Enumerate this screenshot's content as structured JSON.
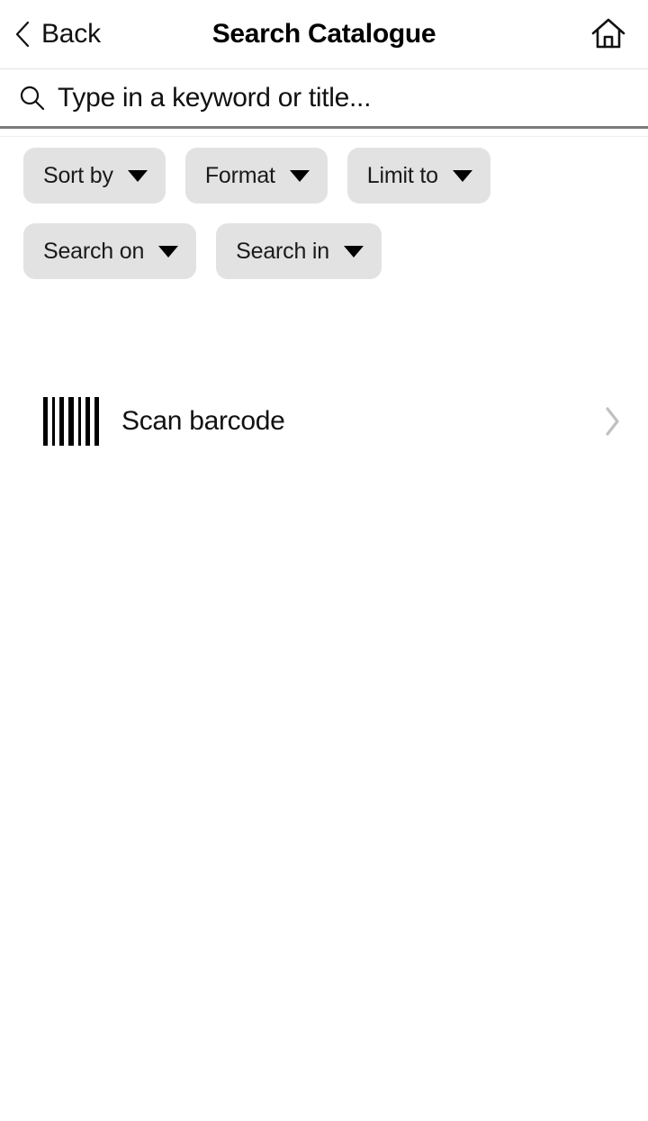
{
  "header": {
    "back_label": "Back",
    "title": "Search Catalogue",
    "back_icon": "chevron-left-icon",
    "home_icon": "home-icon"
  },
  "search": {
    "icon": "search-icon",
    "value": "",
    "placeholder": "Type in a keyword or title..."
  },
  "filters": {
    "rows": [
      [
        {
          "label": "Sort by",
          "icon": "caret-down-icon"
        },
        {
          "label": "Format",
          "icon": "caret-down-icon"
        },
        {
          "label": "Limit to",
          "icon": "caret-down-icon"
        }
      ],
      [
        {
          "label": "Search on",
          "icon": "caret-down-icon"
        },
        {
          "label": "Search in",
          "icon": "caret-down-icon"
        }
      ]
    ]
  },
  "scan": {
    "label": "Scan barcode",
    "icon": "barcode-icon",
    "chevron": "chevron-right-icon"
  },
  "colors": {
    "background": "#ffffff",
    "text": "#111111",
    "chip_background": "#e2e2e2",
    "divider": "#e3e3e3",
    "search_underline": "#7c7c7c",
    "chevron_right": "#c0c0c0"
  }
}
